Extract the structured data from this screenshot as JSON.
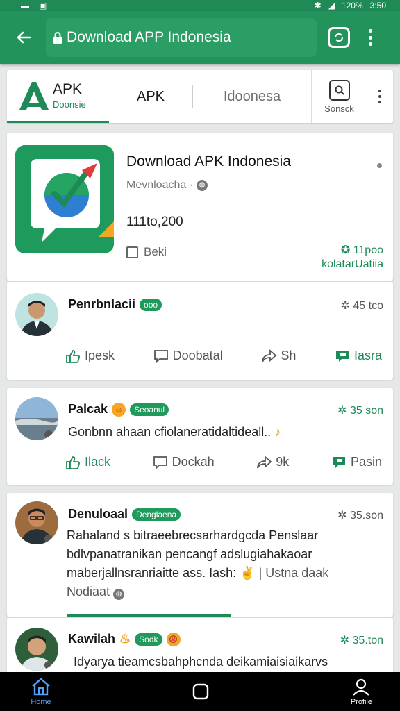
{
  "status": {
    "time": "3:50",
    "battery": "120%"
  },
  "browser": {
    "url": "Download APP Indonesia",
    "tabs_count": ""
  },
  "site": {
    "brand_line1": "APK",
    "brand_line2": "Doonsie",
    "nav_apk": "APK",
    "nav_indonesia": "Idoonesa",
    "search_label": "Sonsck"
  },
  "app": {
    "title": "Download APK Indonesia",
    "subtitle": "Mevnloacha ·",
    "size": "111to,200",
    "check_label": "Beki",
    "stat_count": "11poo",
    "stat_label": "kolatarUatiia"
  },
  "posts": [
    {
      "name": "Penrbnlacii",
      "badge": "ooo",
      "time": "45 tco",
      "actions": {
        "like": "Ipesk",
        "comment": "Doobatal",
        "share": "Sh",
        "save": "Iasra"
      }
    },
    {
      "name": "Palcak",
      "badge": "Seoanul",
      "time": "35 son",
      "body": "Gonbnn ahaan cfiolaneratidaltideall..",
      "actions": {
        "like": "Ilack",
        "comment": "Dockah",
        "share": "9k",
        "save": "Pasin"
      }
    },
    {
      "name": "Denuloaal",
      "badge": "Denglaena",
      "time": "35.son",
      "body_lines": [
        "Rahaland s bitraeebrecsarhardgcda Penslaar",
        "bdlvpanatranikan pencangf adslugiahakaoar",
        "maberjallnsranriaitte ass. Iash:",
        "Nodiaat"
      ],
      "body_tail": "| Ustna daak"
    },
    {
      "name": "Kawilah",
      "badge": "Sodk",
      "time": "35.ton",
      "body": "Idyarya tieamcsbahphcnda deikamiaisiaikarvs"
    }
  ],
  "bottom_nav": {
    "home": "Home",
    "profile": "Profile"
  }
}
